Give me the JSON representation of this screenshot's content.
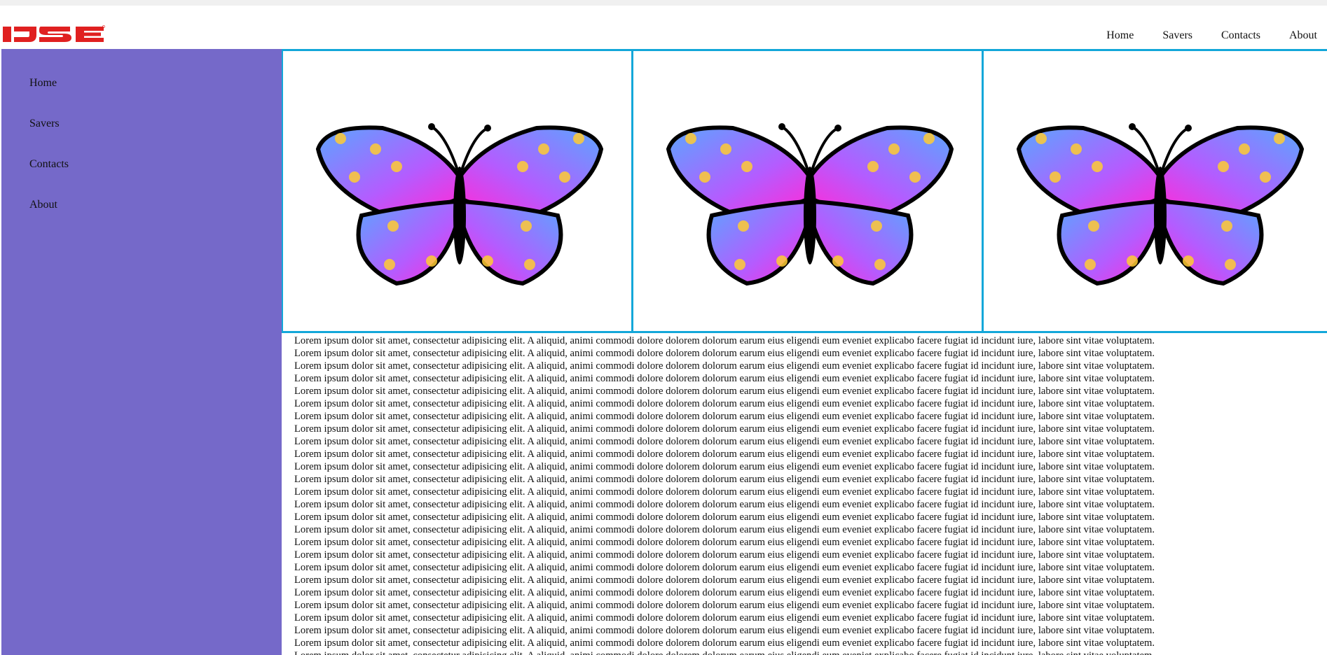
{
  "header": {
    "logo_text": "IJSE",
    "nav": [
      "Home",
      "Savers",
      "Contacts",
      "About"
    ]
  },
  "sidebar": {
    "items": [
      "Home",
      "Savers",
      "Contacts",
      "About"
    ]
  },
  "gallery": {
    "images": [
      "butterfly",
      "butterfly",
      "butterfly"
    ]
  },
  "content": {
    "paragraph": "Lorem ipsum dolor sit amet, consectetur adipisicing elit. A aliquid, animi commodi dolore dolorem dolorum earum eius eligendi eum eveniet explicabo facere fugiat id incidunt iure, labore sint vitae voluptatem."
  },
  "colors": {
    "sidebar": "#7569c9",
    "border": "#13a7d9",
    "logo": "#e02020"
  }
}
